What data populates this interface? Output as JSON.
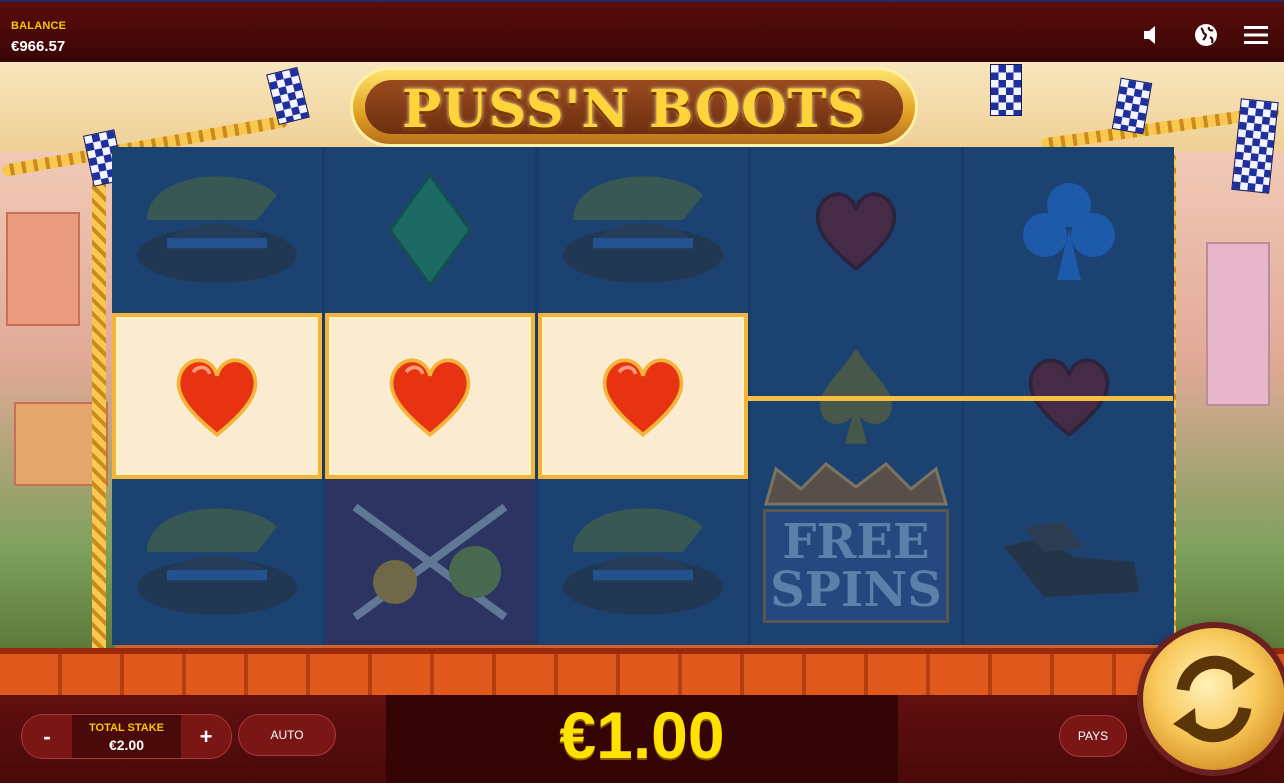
{
  "header": {
    "balance_label": "BALANCE",
    "balance_value": "€966.57",
    "icons": [
      "speaker-icon",
      "globe-icon",
      "menu-icon"
    ]
  },
  "game": {
    "logo_text": "PUSS'N BOOTS",
    "reels": [
      [
        "hat",
        "heart",
        "hat"
      ],
      [
        "diamond",
        "heart",
        "swords"
      ],
      [
        "hat",
        "heart",
        "hat"
      ],
      [
        "heart",
        "spade",
        "free-spins"
      ],
      [
        "club",
        "heart",
        "gloves"
      ]
    ],
    "winning_cells": [
      "reel1-row2",
      "reel2-row2",
      "reel3-row2"
    ],
    "free_spins_text_1": "FREE",
    "free_spins_text_2": "SPINS"
  },
  "controls": {
    "minus_label": "-",
    "plus_label": "+",
    "stake_label": "TOTAL STAKE",
    "stake_value": "€2.00",
    "auto_label": "AUTO",
    "win_amount": "€1.00",
    "pays_label": "PAYS"
  },
  "colors": {
    "accent_yellow": "#ffe200",
    "bar_red": "#611010",
    "reel_blue": "#1c4272",
    "win_highlight": "#f2b539"
  }
}
